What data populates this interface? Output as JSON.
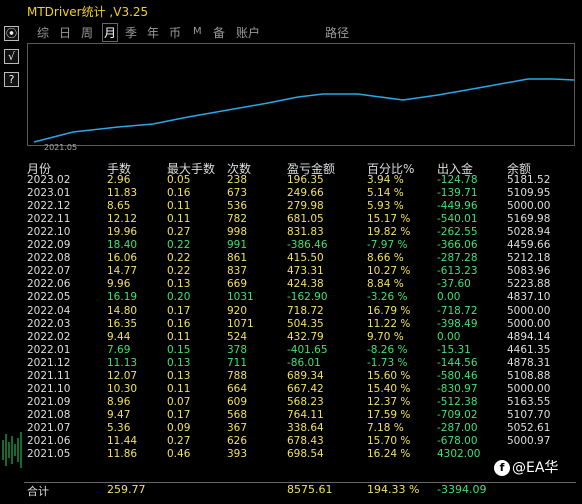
{
  "title": "MTDriver统计 ,V3.25",
  "left_buttons": [
    "⦿",
    "√",
    "?"
  ],
  "tabs": [
    {
      "label": "综",
      "active": false
    },
    {
      "label": "日",
      "active": false
    },
    {
      "label": "周",
      "active": false
    },
    {
      "label": "月",
      "active": true
    },
    {
      "label": "季",
      "active": false
    },
    {
      "label": "年",
      "active": false
    },
    {
      "label": "币",
      "active": false
    },
    {
      "label": "M",
      "active": false
    },
    {
      "label": "备",
      "active": false
    },
    {
      "label": "账户",
      "active": false
    },
    {
      "label": "路径",
      "active": false
    }
  ],
  "chart": {
    "start_label": "2021.05",
    "line_color": "#2aa7e6"
  },
  "columns": [
    "月份",
    "手数",
    "最大手数",
    "次数",
    "盈亏金额",
    "百分比%",
    "出入金",
    "余额"
  ],
  "rows": [
    {
      "month": "2023.02",
      "lots": "2.96",
      "max": "0.05",
      "count": "238",
      "pnl": "196.35",
      "pct": "3.94 %",
      "flow": "-124.78",
      "bal": "5181.52",
      "neg": false
    },
    {
      "month": "2023.01",
      "lots": "11.83",
      "max": "0.16",
      "count": "673",
      "pnl": "249.66",
      "pct": "5.14 %",
      "flow": "-139.71",
      "bal": "5109.95",
      "neg": false
    },
    {
      "month": "2022.12",
      "lots": "8.65",
      "max": "0.11",
      "count": "536",
      "pnl": "279.98",
      "pct": "5.93 %",
      "flow": "-449.96",
      "bal": "5000.00",
      "neg": false
    },
    {
      "month": "2022.11",
      "lots": "12.12",
      "max": "0.11",
      "count": "782",
      "pnl": "681.05",
      "pct": "15.17 %",
      "flow": "-540.01",
      "bal": "5169.98",
      "neg": false
    },
    {
      "month": "2022.10",
      "lots": "19.96",
      "max": "0.27",
      "count": "998",
      "pnl": "831.83",
      "pct": "19.82 %",
      "flow": "-262.55",
      "bal": "5028.94",
      "neg": false
    },
    {
      "month": "2022.09",
      "lots": "18.40",
      "max": "0.22",
      "count": "991",
      "pnl": "-386.46",
      "pct": "-7.97 %",
      "flow": "-366.06",
      "bal": "4459.66",
      "neg": true
    },
    {
      "month": "2022.08",
      "lots": "16.06",
      "max": "0.22",
      "count": "861",
      "pnl": "415.50",
      "pct": "8.66 %",
      "flow": "-287.28",
      "bal": "5212.18",
      "neg": false
    },
    {
      "month": "2022.07",
      "lots": "14.77",
      "max": "0.22",
      "count": "837",
      "pnl": "473.31",
      "pct": "10.27 %",
      "flow": "-613.23",
      "bal": "5083.96",
      "neg": false
    },
    {
      "month": "2022.06",
      "lots": "9.96",
      "max": "0.13",
      "count": "669",
      "pnl": "424.38",
      "pct": "8.84 %",
      "flow": "-37.60",
      "bal": "5223.88",
      "neg": false
    },
    {
      "month": "2022.05",
      "lots": "16.19",
      "max": "0.20",
      "count": "1031",
      "pnl": "-162.90",
      "pct": "-3.26 %",
      "flow": "0.00",
      "bal": "4837.10",
      "neg": true
    },
    {
      "month": "2022.04",
      "lots": "14.80",
      "max": "0.17",
      "count": "920",
      "pnl": "718.72",
      "pct": "16.79 %",
      "flow": "-718.72",
      "bal": "5000.00",
      "neg": false
    },
    {
      "month": "2022.03",
      "lots": "16.35",
      "max": "0.16",
      "count": "1071",
      "pnl": "504.35",
      "pct": "11.22 %",
      "flow": "-398.49",
      "bal": "5000.00",
      "neg": false
    },
    {
      "month": "2022.02",
      "lots": "9.44",
      "max": "0.11",
      "count": "524",
      "pnl": "432.79",
      "pct": "9.70 %",
      "flow": "0.00",
      "bal": "4894.14",
      "neg": false
    },
    {
      "month": "2022.01",
      "lots": "7.69",
      "max": "0.15",
      "count": "378",
      "pnl": "-401.65",
      "pct": "-8.26 %",
      "flow": "-15.31",
      "bal": "4461.35",
      "neg": true
    },
    {
      "month": "2021.12",
      "lots": "11.13",
      "max": "0.13",
      "count": "711",
      "pnl": "-86.01",
      "pct": "-1.73 %",
      "flow": "-144.56",
      "bal": "4878.31",
      "neg": true
    },
    {
      "month": "2021.11",
      "lots": "12.07",
      "max": "0.13",
      "count": "788",
      "pnl": "689.34",
      "pct": "15.60 %",
      "flow": "-580.46",
      "bal": "5108.88",
      "neg": false
    },
    {
      "month": "2021.10",
      "lots": "10.30",
      "max": "0.11",
      "count": "664",
      "pnl": "667.42",
      "pct": "15.40 %",
      "flow": "-830.97",
      "bal": "5000.00",
      "neg": false
    },
    {
      "month": "2021.09",
      "lots": "8.96",
      "max": "0.07",
      "count": "609",
      "pnl": "568.23",
      "pct": "12.37 %",
      "flow": "-512.38",
      "bal": "5163.55",
      "neg": false
    },
    {
      "month": "2021.08",
      "lots": "9.47",
      "max": "0.17",
      "count": "568",
      "pnl": "764.11",
      "pct": "17.59 %",
      "flow": "-709.02",
      "bal": "5107.70",
      "neg": false
    },
    {
      "month": "2021.07",
      "lots": "5.36",
      "max": "0.09",
      "count": "367",
      "pnl": "338.64",
      "pct": "7.18 %",
      "flow": "-287.00",
      "bal": "5052.61",
      "neg": false
    },
    {
      "month": "2021.06",
      "lots": "11.44",
      "max": "0.27",
      "count": "626",
      "pnl": "678.43",
      "pct": "15.70 %",
      "flow": "-678.00",
      "bal": "5000.97",
      "neg": false
    },
    {
      "month": "2021.05",
      "lots": "11.86",
      "max": "0.46",
      "count": "393",
      "pnl": "698.54",
      "pct": "16.24 %",
      "flow": "4302.00",
      "bal": "",
      "neg": false
    }
  ],
  "total": {
    "label": "合计",
    "lots": "259.77",
    "pnl": "8575.61",
    "pct": "194.33 %",
    "flow": "-3394.09"
  },
  "watermark": "@EA华",
  "colors": {
    "positive": "#f0e060",
    "negative": "#40e070",
    "flow": "#40e070",
    "month": "#dddddd",
    "balance": "#dddddd"
  }
}
